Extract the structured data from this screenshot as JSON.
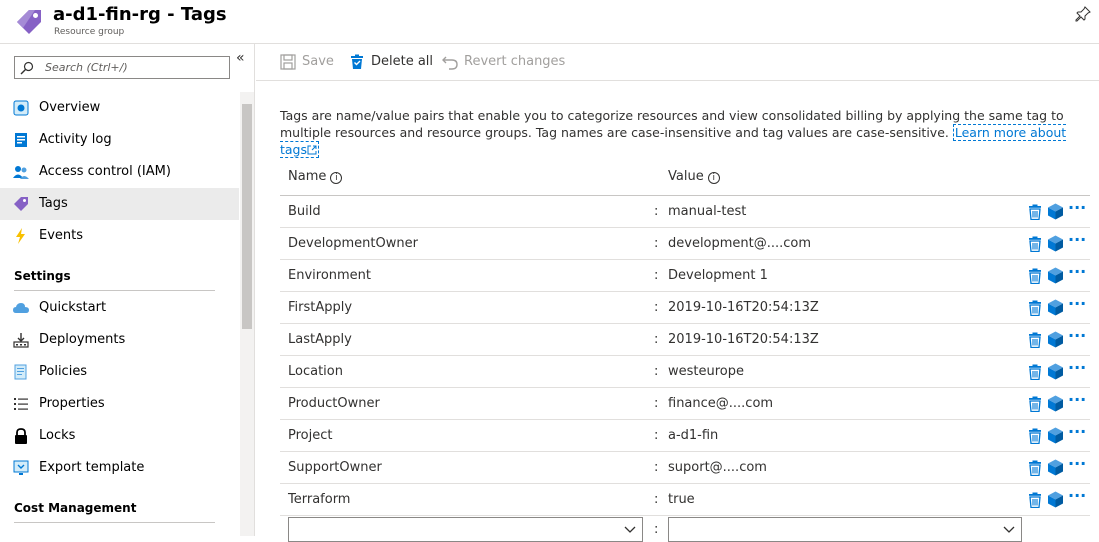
{
  "header": {
    "title": "a-d1-fin-rg - Tags",
    "subtitle": "Resource group"
  },
  "sidebar": {
    "search_placeholder": "Search (Ctrl+/)",
    "collapse_glyph": "«",
    "items": [
      {
        "label": "Overview",
        "icon": "overview-icon"
      },
      {
        "label": "Activity log",
        "icon": "activity-log-icon"
      },
      {
        "label": "Access control (IAM)",
        "icon": "access-control-icon"
      },
      {
        "label": "Tags",
        "icon": "tag-icon"
      },
      {
        "label": "Events",
        "icon": "lightning-icon"
      }
    ],
    "settings_title": "Settings",
    "settings_items": [
      {
        "label": "Quickstart",
        "icon": "cloud-icon"
      },
      {
        "label": "Deployments",
        "icon": "deployments-icon"
      },
      {
        "label": "Policies",
        "icon": "policies-icon"
      },
      {
        "label": "Properties",
        "icon": "properties-icon"
      },
      {
        "label": "Locks",
        "icon": "lock-icon"
      },
      {
        "label": "Export template",
        "icon": "export-template-icon"
      }
    ],
    "cost_title": "Cost Management"
  },
  "toolbar": {
    "save_label": "Save",
    "delete_all_label": "Delete all",
    "revert_label": "Revert changes"
  },
  "content": {
    "description": "Tags are name/value pairs that enable you to categorize resources and view consolidated billing by applying the same tag to multiple resources and resource groups. Tag names are case-insensitive and tag values are case-sensitive.",
    "learn_more": "Learn more about tags",
    "col_name": "Name",
    "col_value": "Value",
    "separator": ":",
    "more_glyph": "···",
    "tags": [
      {
        "name": "Build",
        "value": "manual-test"
      },
      {
        "name": "DevelopmentOwner",
        "value": "development@....com"
      },
      {
        "name": "Environment",
        "value": "Development 1"
      },
      {
        "name": "FirstApply",
        "value": "2019-10-16T20:54:13Z"
      },
      {
        "name": "LastApply",
        "value": "2019-10-16T20:54:13Z"
      },
      {
        "name": "Location",
        "value": "westeurope"
      },
      {
        "name": "ProductOwner",
        "value": "finance@....com"
      },
      {
        "name": "Project",
        "value": "a-d1-fin"
      },
      {
        "name": "SupportOwner",
        "value": "suport@....com"
      },
      {
        "name": "Terraform",
        "value": "true"
      }
    ]
  },
  "colors": {
    "accent": "#0078d4",
    "tag_purple": "#8661c5"
  }
}
